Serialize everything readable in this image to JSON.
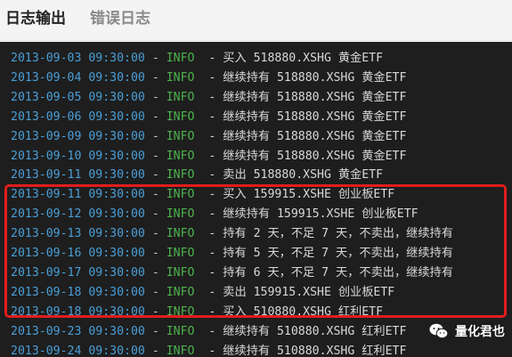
{
  "tabs": [
    {
      "label": "日志输出",
      "active": true
    },
    {
      "label": "错误日志",
      "active": false
    }
  ],
  "log": {
    "separator": "-",
    "lines": [
      {
        "timestamp": "2013-09-03 09:30:00",
        "level": "INFO",
        "message": "- 买入 518880.XSHG 黄金ETF"
      },
      {
        "timestamp": "2013-09-04 09:30:00",
        "level": "INFO",
        "message": "- 继续持有 518880.XSHG 黄金ETF"
      },
      {
        "timestamp": "2013-09-05 09:30:00",
        "level": "INFO",
        "message": "- 继续持有 518880.XSHG 黄金ETF"
      },
      {
        "timestamp": "2013-09-06 09:30:00",
        "level": "INFO",
        "message": "- 继续持有 518880.XSHG 黄金ETF"
      },
      {
        "timestamp": "2013-09-09 09:30:00",
        "level": "INFO",
        "message": "- 继续持有 518880.XSHG 黄金ETF"
      },
      {
        "timestamp": "2013-09-10 09:30:00",
        "level": "INFO",
        "message": "- 继续持有 518880.XSHG 黄金ETF"
      },
      {
        "timestamp": "2013-09-11 09:30:00",
        "level": "INFO",
        "message": "- 卖出 518880.XSHG 黄金ETF"
      },
      {
        "timestamp": "2013-09-11 09:30:00",
        "level": "INFO",
        "message": "- 买入 159915.XSHE 创业板ETF"
      },
      {
        "timestamp": "2013-09-12 09:30:00",
        "level": "INFO",
        "message": "- 继续持有 159915.XSHE 创业板ETF"
      },
      {
        "timestamp": "2013-09-13 09:30:00",
        "level": "INFO",
        "message": "- 持有 2 天，不足 7 天，不卖出，继续持有"
      },
      {
        "timestamp": "2013-09-16 09:30:00",
        "level": "INFO",
        "message": "- 持有 5 天，不足 7 天，不卖出，继续持有"
      },
      {
        "timestamp": "2013-09-17 09:30:00",
        "level": "INFO",
        "message": "- 持有 6 天，不足 7 天，不卖出，继续持有"
      },
      {
        "timestamp": "2013-09-18 09:30:00",
        "level": "INFO",
        "message": "- 卖出 159915.XSHE 创业板ETF"
      },
      {
        "timestamp": "2013-09-18 09:30:00",
        "level": "INFO",
        "message": "- 买入 510880.XSHG 红利ETF"
      },
      {
        "timestamp": "2013-09-23 09:30:00",
        "level": "INFO",
        "message": "- 继续持有 510880.XSHG 红利ETF"
      },
      {
        "timestamp": "2013-09-24 09:30:00",
        "level": "INFO",
        "message": "- 继续持有 510880.XSHG 红利ETF"
      }
    ]
  },
  "watermark": {
    "icon": "wechat-icon",
    "text": "量化君也"
  },
  "colors": {
    "console_bg": "#1e1e1e",
    "timestamp": "#4a9fd8",
    "level": "#4db34d",
    "message": "#d8d8d8",
    "highlight_border": "#e11d1d"
  }
}
